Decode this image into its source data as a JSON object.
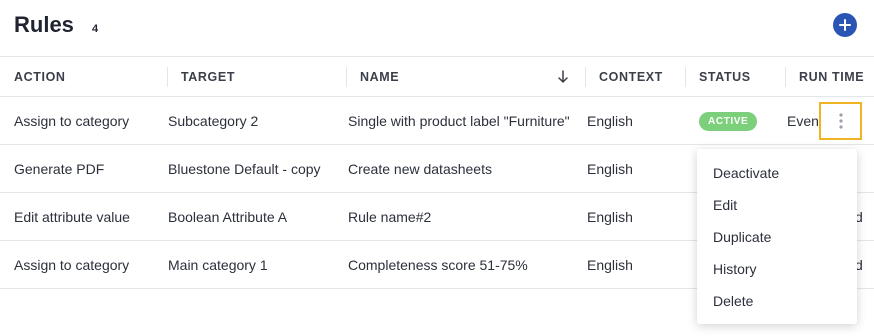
{
  "header": {
    "title": "Rules",
    "count": "4",
    "add_icon": "plus-circle-icon",
    "accent_color": "#2a55b5"
  },
  "table": {
    "columns": [
      "ACTION",
      "TARGET",
      "NAME",
      "CONTEXT",
      "STATUS",
      "RUN TIME"
    ],
    "sort_icon": "arrow-down-icon",
    "rows": [
      {
        "action": "Assign to category",
        "target": "Subcategory 2",
        "name": "Single with product label \"Furniture\"",
        "context": "English",
        "status": "ACTIVE",
        "run_time": "Even"
      },
      {
        "action": "Generate PDF",
        "target": "Bluestone Default - copy",
        "name": "Create new datasheets",
        "context": "English",
        "status": "",
        "run_time": ""
      },
      {
        "action": "Edit attribute value",
        "target": "Boolean Attribute A",
        "name": "Rule name#2",
        "context": "English",
        "status": "",
        "run_time": "d"
      },
      {
        "action": "Assign to category",
        "target": "Main category 1",
        "name": "Completeness score 51-75%",
        "context": "English",
        "status": "",
        "run_time": "d"
      }
    ],
    "status_color": "#7ccf7b"
  },
  "row_menu": {
    "kebab_icon": "kebab-vertical-icon",
    "highlight_color": "#f0b323",
    "items": [
      "Deactivate",
      "Edit",
      "Duplicate",
      "History",
      "Delete"
    ]
  }
}
